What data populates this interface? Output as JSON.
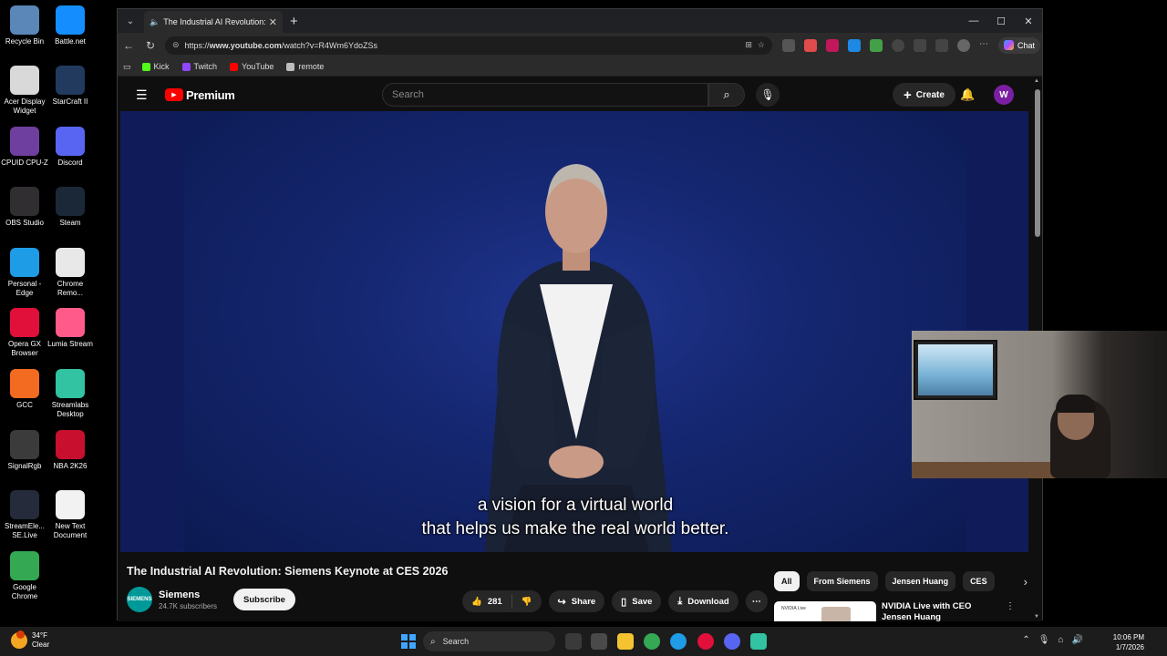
{
  "desktop": {
    "icons": [
      {
        "label": "Recycle Bin",
        "icon": "recycle-bin-icon",
        "color": "#5a87b8"
      },
      {
        "label": "Battle.net",
        "icon": "battlenet-icon",
        "color": "#148eff"
      },
      {
        "label": "Acer Display Widget",
        "icon": "acer-display-icon",
        "color": "#d9d9d9"
      },
      {
        "label": "StarCraft II",
        "icon": "starcraft-icon",
        "color": "#223a5e"
      },
      {
        "label": "CPUID CPU-Z",
        "icon": "cpuz-icon",
        "color": "#6f3fa0"
      },
      {
        "label": "Discord",
        "icon": "discord-icon",
        "color": "#5865f2"
      },
      {
        "label": "OBS Studio",
        "icon": "obs-icon",
        "color": "#302e31"
      },
      {
        "label": "Steam",
        "icon": "steam-icon",
        "color": "#1b2838"
      },
      {
        "label": "Personal - Edge",
        "icon": "edge-icon",
        "color": "#1f9ce6"
      },
      {
        "label": "Chrome Remo...",
        "icon": "chrome-remote-icon",
        "color": "#e8e8e8"
      },
      {
        "label": "Opera GX Browser",
        "icon": "opera-gx-icon",
        "color": "#e0103a"
      },
      {
        "label": "Lumia Stream",
        "icon": "lumia-icon",
        "color": "#ff5a8a"
      },
      {
        "label": "GCC",
        "icon": "gcc-icon",
        "color": "#f26b21"
      },
      {
        "label": "Streamlabs Desktop",
        "icon": "streamlabs-icon",
        "color": "#31c3a2"
      },
      {
        "label": "SignalRgb",
        "icon": "signalrgb-icon",
        "color": "#3b3b3b"
      },
      {
        "label": "NBA 2K26",
        "icon": "nba2k-icon",
        "color": "#c8102e"
      },
      {
        "label": "StreamEle... SE.Live",
        "icon": "streamelements-icon",
        "color": "#252b3b"
      },
      {
        "label": "New Text Document",
        "icon": "text-document-icon",
        "color": "#f2f2f2"
      },
      {
        "label": "Google Chrome",
        "icon": "chrome-icon",
        "color": "#34a853"
      }
    ]
  },
  "browser": {
    "tab_title": "The Industrial AI Revolution: S",
    "url_prefix": "https://",
    "url_host": "www.youtube.com",
    "url_path": "/watch?v=R4Wm6YdoZSs",
    "chat_label": "Chat",
    "bookmarks": [
      {
        "label": "Kick",
        "color": "#53fc18"
      },
      {
        "label": "Twitch",
        "color": "#9146ff"
      },
      {
        "label": "YouTube",
        "color": "#ff0000"
      },
      {
        "label": "remote",
        "color": "#bdbdbd"
      }
    ]
  },
  "youtube": {
    "brand": "Premium",
    "search_placeholder": "Search",
    "create_label": "Create",
    "avatar_letter": "W",
    "subtitle_line1": "a vision for a virtual world",
    "subtitle_line2": "that helps us make the real world better.",
    "video_title": "The Industrial AI Revolution: Siemens Keynote at CES 2026",
    "channel_name": "Siemens",
    "channel_logo_text": "SIEMENS",
    "channel_subs": "24.7K subscribers",
    "subscribe_label": "Subscribe",
    "likes": "281",
    "share_label": "Share",
    "save_label": "Save",
    "download_label": "Download",
    "chips": [
      "All",
      "From Siemens",
      "Jensen Huang",
      "CES"
    ],
    "rec_title": "NVIDIA Live with CEO Jensen Huang",
    "rec_thumb_text": "NVIDIA Live"
  },
  "taskbar": {
    "temp": "34°F",
    "condition": "Clear",
    "search_label": "Search",
    "time": "10:06 PM",
    "date": "1/7/2026"
  }
}
